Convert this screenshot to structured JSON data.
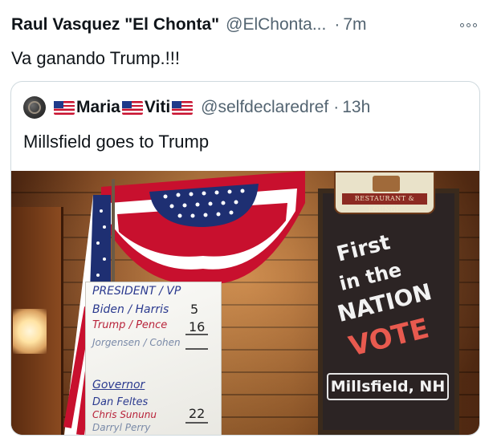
{
  "tweet": {
    "author_name": "Raul Vasquez \"El Chonta\"",
    "author_handle": "@ElChonta...",
    "separator": "·",
    "timestamp": "7m",
    "text": "Va ganando Trump.!!!"
  },
  "quoted_tweet": {
    "name_parts": [
      "Maria",
      "Viti"
    ],
    "handle": "@selfdeclaredref",
    "separator": "·",
    "timestamp": "13h",
    "text": "Millsfield goes to Trump",
    "photo": {
      "whiteboard": {
        "header": "PRESIDENT / VP",
        "lines": [
          {
            "label": "Biden / Harris",
            "value": "5"
          },
          {
            "label": "Trump / Pence",
            "value": "16"
          },
          {
            "label": "Jorgensen / Cohen",
            "value": ""
          },
          {
            "label": "Governor",
            "value": ""
          },
          {
            "label": "Dan Feltes",
            "value": ""
          },
          {
            "label": "Chris Sununu",
            "value": "22"
          },
          {
            "label": "Darryl Perry",
            "value": ""
          }
        ]
      },
      "sign": {
        "banner": "RESTAURANT & LOUNGE",
        "lines": [
          "First",
          "in the",
          "NATION"
        ],
        "vote_word": "VOTE",
        "location": "Millsfield, NH"
      }
    }
  },
  "colors": {
    "text_primary": "#0f1419",
    "text_secondary": "#536471",
    "border": "#cfd9de"
  },
  "icons": {
    "more": "more-options-icon",
    "flag": "us-flag-emoji"
  }
}
